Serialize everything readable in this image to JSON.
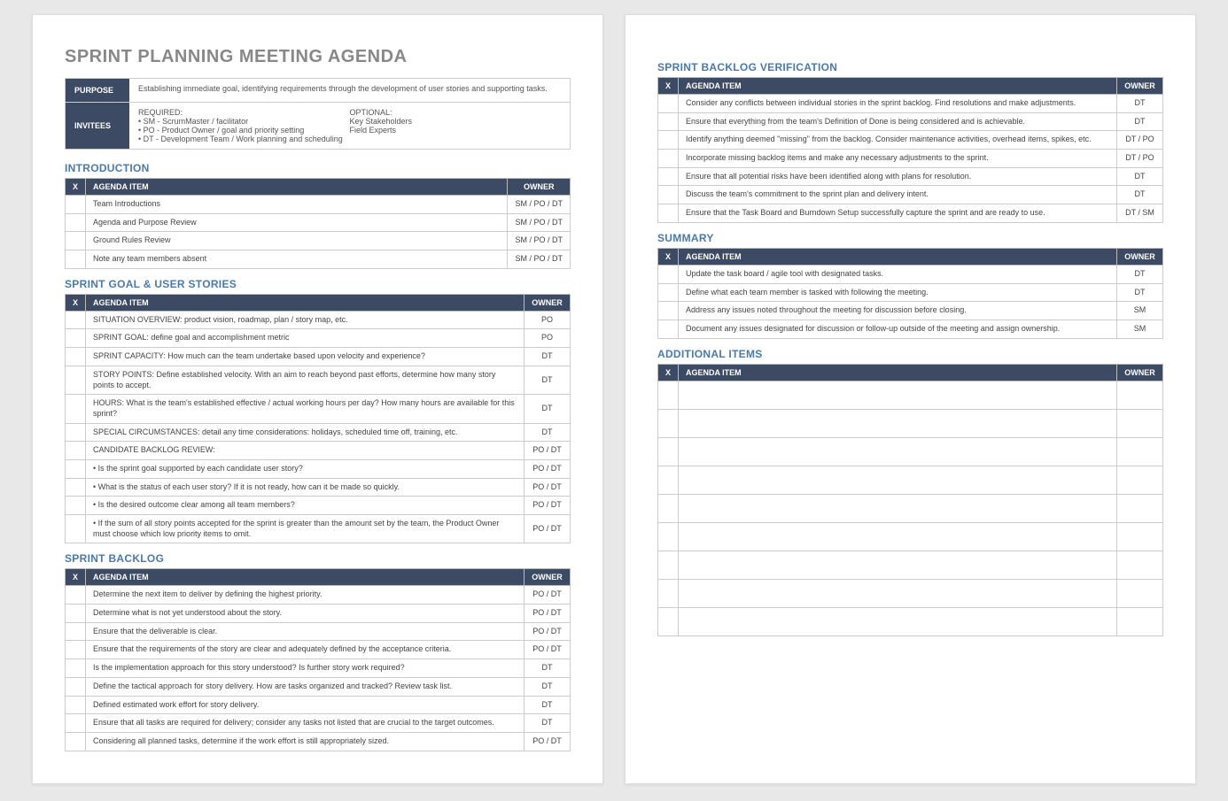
{
  "title": "SPRINT PLANNING MEETING AGENDA",
  "meta": {
    "purpose_label": "PURPOSE",
    "purpose_text": "Establishing immediate goal, identifying requirements through the development of user stories and supporting tasks.",
    "invitees_label": "INVITEES",
    "required_label": "REQUIRED:",
    "required_items": [
      "SM - ScrumMaster / facilitator",
      "PO - Product Owner / goal and priority setting",
      "DT - Development Team / Work planning and scheduling"
    ],
    "optional_label": "OPTIONAL:",
    "optional_items": [
      "Key Stakeholders",
      "Field Experts"
    ]
  },
  "headers": {
    "x": "X",
    "item": "AGENDA ITEM",
    "owner": "OWNER"
  },
  "sections": {
    "introduction": {
      "title": "INTRODUCTION",
      "rows": [
        {
          "item": "Team Introductions",
          "owner": "SM / PO / DT"
        },
        {
          "item": "Agenda and Purpose Review",
          "owner": "SM / PO / DT"
        },
        {
          "item": "Ground Rules Review",
          "owner": "SM / PO / DT"
        },
        {
          "item": "Note any team members absent",
          "owner": "SM / PO / DT"
        }
      ]
    },
    "goal": {
      "title": "SPRINT GOAL & USER STORIES",
      "rows": [
        {
          "item": "SITUATION OVERVIEW: product vision, roadmap, plan / story map, etc.",
          "owner": "PO"
        },
        {
          "item": "SPRINT GOAL: define goal and accomplishment metric",
          "owner": "PO"
        },
        {
          "item": "SPRINT CAPACITY: How much can the team undertake based upon velocity and experience?",
          "owner": "DT"
        },
        {
          "item": "STORY POINTS: Define established velocity. With an aim to reach beyond past efforts, determine how many story points to accept.",
          "owner": "DT"
        },
        {
          "item": "HOURS: What is the team's established effective / actual working hours per day? How many hours are available for this sprint?",
          "owner": "DT"
        },
        {
          "item": "SPECIAL CIRCUMSTANCES: detail any time considerations: holidays, scheduled time off, training, etc.",
          "owner": "DT"
        },
        {
          "item": "CANDIDATE BACKLOG REVIEW:",
          "owner": "PO / DT"
        },
        {
          "item": "• Is the sprint goal supported by each candidate user story?",
          "owner": "PO / DT"
        },
        {
          "item": "• What is the status of each user story? If it is not ready, how can it be made so quickly.",
          "owner": "PO / DT"
        },
        {
          "item": "• Is the desired outcome clear among all team members?",
          "owner": "PO / DT"
        },
        {
          "item": "• If the sum of all story points accepted for the sprint is greater than the amount set by the team, the Product Owner must choose which low priority items to omit.",
          "owner": "PO / DT"
        }
      ]
    },
    "backlog": {
      "title": "SPRINT BACKLOG",
      "rows": [
        {
          "item": "Determine the next item to deliver by defining the highest priority.",
          "owner": "PO / DT"
        },
        {
          "item": "Determine what is not yet understood about the story.",
          "owner": "PO / DT"
        },
        {
          "item": "Ensure that the deliverable is clear.",
          "owner": "PO / DT"
        },
        {
          "item": "Ensure that the requirements of the story are clear and adequately defined by the acceptance criteria.",
          "owner": "PO / DT"
        },
        {
          "item": "Is the implementation approach for this story understood?  Is further story work required?",
          "owner": "DT"
        },
        {
          "item": "Define the tactical approach for story delivery.  How are tasks organized and tracked? Review task list.",
          "owner": "DT"
        },
        {
          "item": "Defined estimated work effort for story delivery.",
          "owner": "DT"
        },
        {
          "item": "Ensure that all tasks are required for delivery; consider any tasks not listed that are crucial to the target outcomes.",
          "owner": "DT"
        },
        {
          "item": "Considering all planned tasks, determine if the work effort is still appropriately sized.",
          "owner": "PO / DT"
        }
      ]
    },
    "verification": {
      "title": "SPRINT BACKLOG VERIFICATION",
      "rows": [
        {
          "item": "Consider any conflicts between individual stories in the sprint backlog. Find resolutions and make adjustments.",
          "owner": "DT"
        },
        {
          "item": "Ensure that everything from the team's Definition of Done is being considered and is achievable.",
          "owner": "DT"
        },
        {
          "item": "Identify anything deemed \"missing\" from the backlog. Consider maintenance activities, overhead items, spikes, etc.",
          "owner": "DT / PO"
        },
        {
          "item": "Incorporate missing backlog items and make any necessary adjustments to the sprint.",
          "owner": "DT / PO"
        },
        {
          "item": "Ensure that all potential risks have been identified along with plans for resolution.",
          "owner": "DT"
        },
        {
          "item": "Discuss the team's commitment to the sprint plan and delivery intent.",
          "owner": "DT"
        },
        {
          "item": "Ensure that the Task Board and Burndown Setup successfully capture the sprint and are ready to use.",
          "owner": "DT / SM"
        }
      ]
    },
    "summary": {
      "title": "SUMMARY",
      "rows": [
        {
          "item": "Update the task board / agile tool with designated tasks.",
          "owner": "DT"
        },
        {
          "item": "Define what each team member is tasked with following the meeting.",
          "owner": "DT"
        },
        {
          "item": "Address any issues noted throughout the meeting for discussion before closing.",
          "owner": "SM"
        },
        {
          "item": "Document any issues designated for discussion or follow-up outside of the meeting and assign ownership.",
          "owner": "SM"
        }
      ]
    },
    "additional": {
      "title": "ADDITIONAL ITEMS",
      "empty_rows": 9
    }
  }
}
